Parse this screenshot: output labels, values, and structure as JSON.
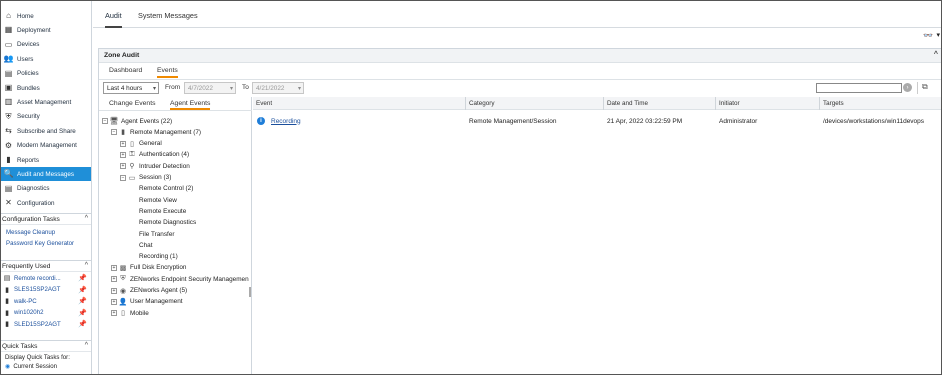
{
  "nav": {
    "items": [
      {
        "label": "Home",
        "icon": "home-icon",
        "glyph": "⌂"
      },
      {
        "label": "Deployment",
        "icon": "deployment-icon",
        "glyph": "▦"
      },
      {
        "label": "Devices",
        "icon": "devices-icon",
        "glyph": "▭"
      },
      {
        "label": "Users",
        "icon": "users-icon",
        "glyph": "👥"
      },
      {
        "label": "Policies",
        "icon": "policies-icon",
        "glyph": "▤"
      },
      {
        "label": "Bundles",
        "icon": "bundles-icon",
        "glyph": "▣"
      },
      {
        "label": "Asset Management",
        "icon": "asset-icon",
        "glyph": "▥"
      },
      {
        "label": "Security",
        "icon": "security-icon",
        "glyph": "⛨"
      },
      {
        "label": "Subscribe and Share",
        "icon": "subscribe-icon",
        "glyph": "⇆"
      },
      {
        "label": "Modern Management",
        "icon": "modern-icon",
        "glyph": "⚙"
      },
      {
        "label": "Reports",
        "icon": "reports-icon",
        "glyph": "▮"
      },
      {
        "label": "Audit and Messages",
        "icon": "audit-icon",
        "glyph": "🔍"
      },
      {
        "label": "Diagnostics",
        "icon": "diagnostics-icon",
        "glyph": "▤"
      },
      {
        "label": "Configuration",
        "icon": "configuration-icon",
        "glyph": "✕"
      }
    ],
    "active_index": 11
  },
  "config_tasks": {
    "title": "Configuration Tasks",
    "links": [
      "Message Cleanup",
      "Password Key Generator"
    ]
  },
  "frequently_used": {
    "title": "Frequently Used",
    "items": [
      "Remote recordi...",
      "SLES15SP2AGT",
      "walk-PC",
      "win1020h2",
      "SLED15SP2AGT"
    ]
  },
  "quick_tasks": {
    "title": "Quick Tasks",
    "display_label": "Display Quick Tasks for:",
    "option": "Current Session"
  },
  "top_tabs": [
    "Audit",
    "System Messages"
  ],
  "panel": {
    "title": "Zone Audit",
    "sub_tabs": [
      "Dashboard",
      "Events"
    ]
  },
  "filters": {
    "range": "Last 4 hours",
    "from_label": "From",
    "from_value": "4/7/2022",
    "to_label": "To",
    "to_value": "4/21/2022"
  },
  "tree_tabs": [
    "Change Events",
    "Agent Events"
  ],
  "tree": [
    {
      "label": "Agent Events (22)",
      "level": 0,
      "toggle": "−",
      "icon": "agent-events-icon",
      "glyph": "🖥"
    },
    {
      "label": "Remote Management (7)",
      "level": 1,
      "toggle": "−",
      "icon": "remote-management-icon",
      "glyph": "▮"
    },
    {
      "label": "General",
      "level": 2,
      "toggle": "+",
      "icon": "general-icon",
      "glyph": "▯"
    },
    {
      "label": "Authentication (4)",
      "level": 2,
      "toggle": "+",
      "icon": "authentication-icon",
      "glyph": "⚿"
    },
    {
      "label": "Intruder Detection",
      "level": 2,
      "toggle": "+",
      "icon": "intruder-icon",
      "glyph": "⚲"
    },
    {
      "label": "Session (3)",
      "level": 2,
      "toggle": "−",
      "icon": "session-icon",
      "glyph": "▭"
    },
    {
      "label": "Remote Control (2)",
      "level": 3,
      "toggle": "",
      "icon": "",
      "glyph": ""
    },
    {
      "label": "Remote View",
      "level": 3,
      "toggle": "",
      "icon": "",
      "glyph": ""
    },
    {
      "label": "Remote Execute",
      "level": 3,
      "toggle": "",
      "icon": "",
      "glyph": ""
    },
    {
      "label": "Remote Diagnostics",
      "level": 3,
      "toggle": "",
      "icon": "",
      "glyph": ""
    },
    {
      "label": "File Transfer",
      "level": 3,
      "toggle": "",
      "icon": "",
      "glyph": ""
    },
    {
      "label": "Chat",
      "level": 3,
      "toggle": "",
      "icon": "",
      "glyph": ""
    },
    {
      "label": "Recording (1)",
      "level": 3,
      "toggle": "",
      "icon": "",
      "glyph": ""
    },
    {
      "label": "Full Disk Encryption",
      "level": 1,
      "toggle": "+",
      "icon": "disk-encryption-icon",
      "glyph": "▩"
    },
    {
      "label": "ZENworks Endpoint Security Managemen",
      "level": 1,
      "toggle": "+",
      "icon": "endpoint-security-icon",
      "glyph": "⛨"
    },
    {
      "label": "ZENworks Agent (5)",
      "level": 1,
      "toggle": "+",
      "icon": "zenworks-agent-icon",
      "glyph": "◉"
    },
    {
      "label": "User Management",
      "level": 1,
      "toggle": "+",
      "icon": "user-management-icon",
      "glyph": "👤"
    },
    {
      "label": "Mobile",
      "level": 1,
      "toggle": "+",
      "icon": "mobile-icon",
      "glyph": "▯"
    }
  ],
  "grid": {
    "columns": [
      "Event",
      "Category",
      "Date and Time",
      "Initiator",
      "Targets"
    ],
    "rows": [
      {
        "event": "Recording",
        "category": "Remote Management/Session",
        "datetime": "21 Apr, 2022 03:22:59 PM",
        "initiator": "Administrator",
        "targets": "/devices/workstations/win11devops"
      }
    ]
  },
  "colors": {
    "accent": "#1f8fd8",
    "tab_underline": "#f08a00",
    "link": "#1b4f9c"
  }
}
